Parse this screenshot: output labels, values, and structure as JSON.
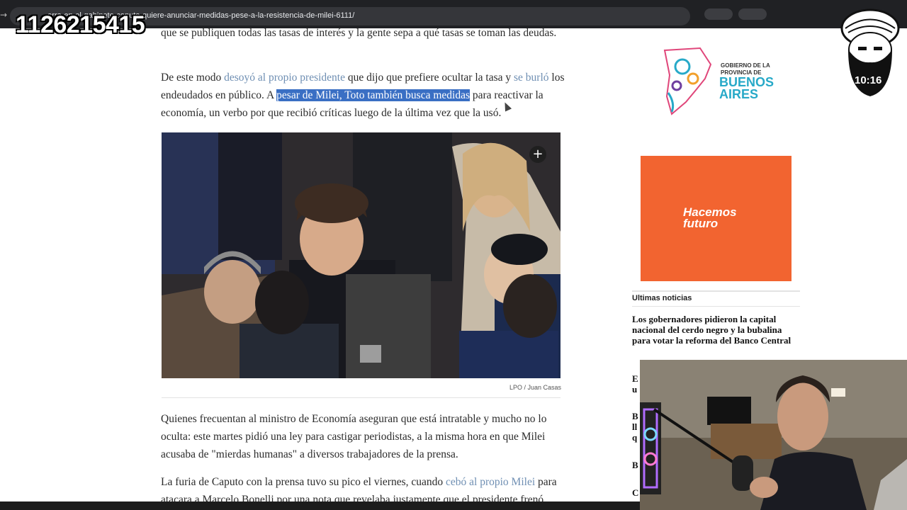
{
  "browser": {
    "url_prefix": "...",
    "url_visible": "erra-en-el-gabinete-caputo-quiere-anunciar-medidas-pese-a-la-resistencia-de-milei-6111/"
  },
  "overlay": {
    "phone_number": "1126215415",
    "timer": "10:16"
  },
  "article": {
    "p0": "que se publiquen todas las tasas de interés y la gente sepa a qué tasas se toman las deudas.",
    "p1": {
      "t1": "De este modo ",
      "link1": "desoyó al propio presidente",
      "t2": " que dijo que prefiere ocultar la tasa y ",
      "link2": "se burló",
      "t3": " los endeudados en público. A ",
      "highlight": "pesar de Milei, Toto también busca medidas",
      "t4": " para reactivar la economía, un verbo por que recibió críticas luego de la última vez que la usó."
    },
    "image_caption": "LPO / Juan Casas",
    "p2": "Quienes frecuentan al ministro de Economía aseguran que está intratable y mucho no lo oculta: este martes pidió una ley para castigar periodistas, a la misma hora en que Milei acusaba de \"mierdas humanas\" a diversos trabajadores de la prensa.",
    "p3": {
      "t1": "La furia de Caputo con la prensa tuvo su pico el viernes, cuando ",
      "link": "cebó al propio Milei",
      "t2": " para atacara a Marcelo Bonelli por una nota que revelaba justamente que el presidente frenó"
    }
  },
  "sidebar": {
    "gba_small": "GOBIERNO DE LA\nPROVINCIA DE",
    "gba_big": "BUENOS\nAIRES",
    "ad_line1": "Hacemos",
    "ad_line2": "futuro",
    "news_heading": "Ultimas noticias",
    "news_item_1": "Los gobernadores pidieron la capital nacional del cerdo negro y la bubalina para votar la reforma del Banco Central",
    "stubs": [
      "E",
      "u",
      "B",
      "ll",
      "q",
      "B",
      "C"
    ]
  }
}
